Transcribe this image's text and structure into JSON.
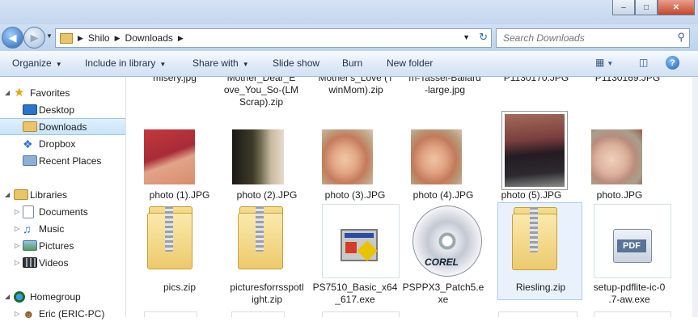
{
  "window": {
    "buttons": {
      "minimize": "–",
      "maximize": "□",
      "close": "✕"
    }
  },
  "address": {
    "crumbs": [
      "Shilo",
      "Downloads"
    ],
    "search_placeholder": "Search Downloads"
  },
  "toolbar": {
    "organize": "Organize",
    "include": "Include in library",
    "share": "Share with",
    "slideshow": "Slide show",
    "burn": "Burn",
    "newfolder": "New folder"
  },
  "nav": {
    "favorites": "Favorites",
    "desktop": "Desktop",
    "downloads": "Downloads",
    "dropbox": "Dropbox",
    "recent": "Recent Places",
    "libraries": "Libraries",
    "documents": "Documents",
    "music": "Music",
    "pictures": "Pictures",
    "videos": "Videos",
    "homegroup": "Homegroup",
    "eric": "Eric (ERIC-PC)"
  },
  "row0": {
    "n1": "misery.jpg",
    "n2a": "Mother_Dear_E",
    "n2b": "ove_You_So-(LM",
    "n2c": "Scrap).zip",
    "n3a": "Mother's_Love (T",
    "n3b": "winMom).zip",
    "n4a": "m-Tassel-Ballard",
    "n4b": "-large.jpg",
    "n5": "P1130170.JPG",
    "n6": "P1130169.JPG"
  },
  "row1": {
    "f1": "photo (1).JPG",
    "f2": "photo (2).JPG",
    "f3": "photo (3).JPG",
    "f4": "photo (4).JPG",
    "f5": "photo (5).JPG",
    "f6": "photo.JPG"
  },
  "row2": {
    "f1": "pics.zip",
    "f2a": "picturesforrsspotl",
    "f2b": "ight.zip",
    "f3a": "PS7510_Basic_x64",
    "f3b": "_617.exe",
    "f4a": "PSPPX3_Patch5.e",
    "f4b": "xe",
    "f5": "Riesling.zip",
    "f6a": "setup-pdflite-ic-0",
    "f6b": ".7-aw.exe",
    "corel": "COREL",
    "pdf": "PDF"
  },
  "colors": {
    "accent": "#1f5cb3",
    "selection": "#c8e3f8",
    "folder": "#ecca6d"
  }
}
